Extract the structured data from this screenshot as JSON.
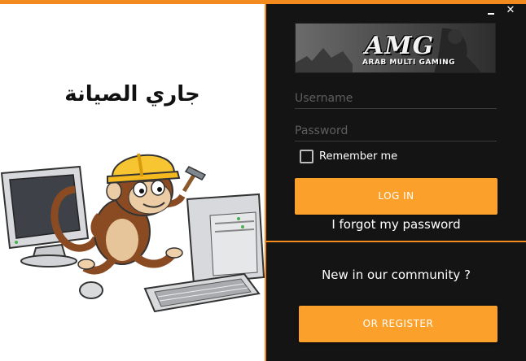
{
  "window": {
    "minimize_icon": "minimize-icon",
    "close_glyph": "✕",
    "close_icon": "close-icon"
  },
  "maintenance": {
    "title": "جاري الصيانة",
    "illustration": "monkey-repairing-computer"
  },
  "banner": {
    "logo": "AMG",
    "subtitle": "ARAB MULTI GAMING"
  },
  "login": {
    "username_placeholder": "Username",
    "username_value": "",
    "password_placeholder": "Password",
    "password_value": "",
    "remember_label": "Remember me",
    "remember_checked": false,
    "login_button": "LOG IN",
    "forgot_link": "I forgot my password"
  },
  "register": {
    "prompt": "New in our community ?",
    "button": "OR REGISTER"
  },
  "colors": {
    "accent": "#fba02a",
    "border_orange": "#f28a1e",
    "panel_dark": "#141414",
    "panel_light": "#ffffff"
  }
}
